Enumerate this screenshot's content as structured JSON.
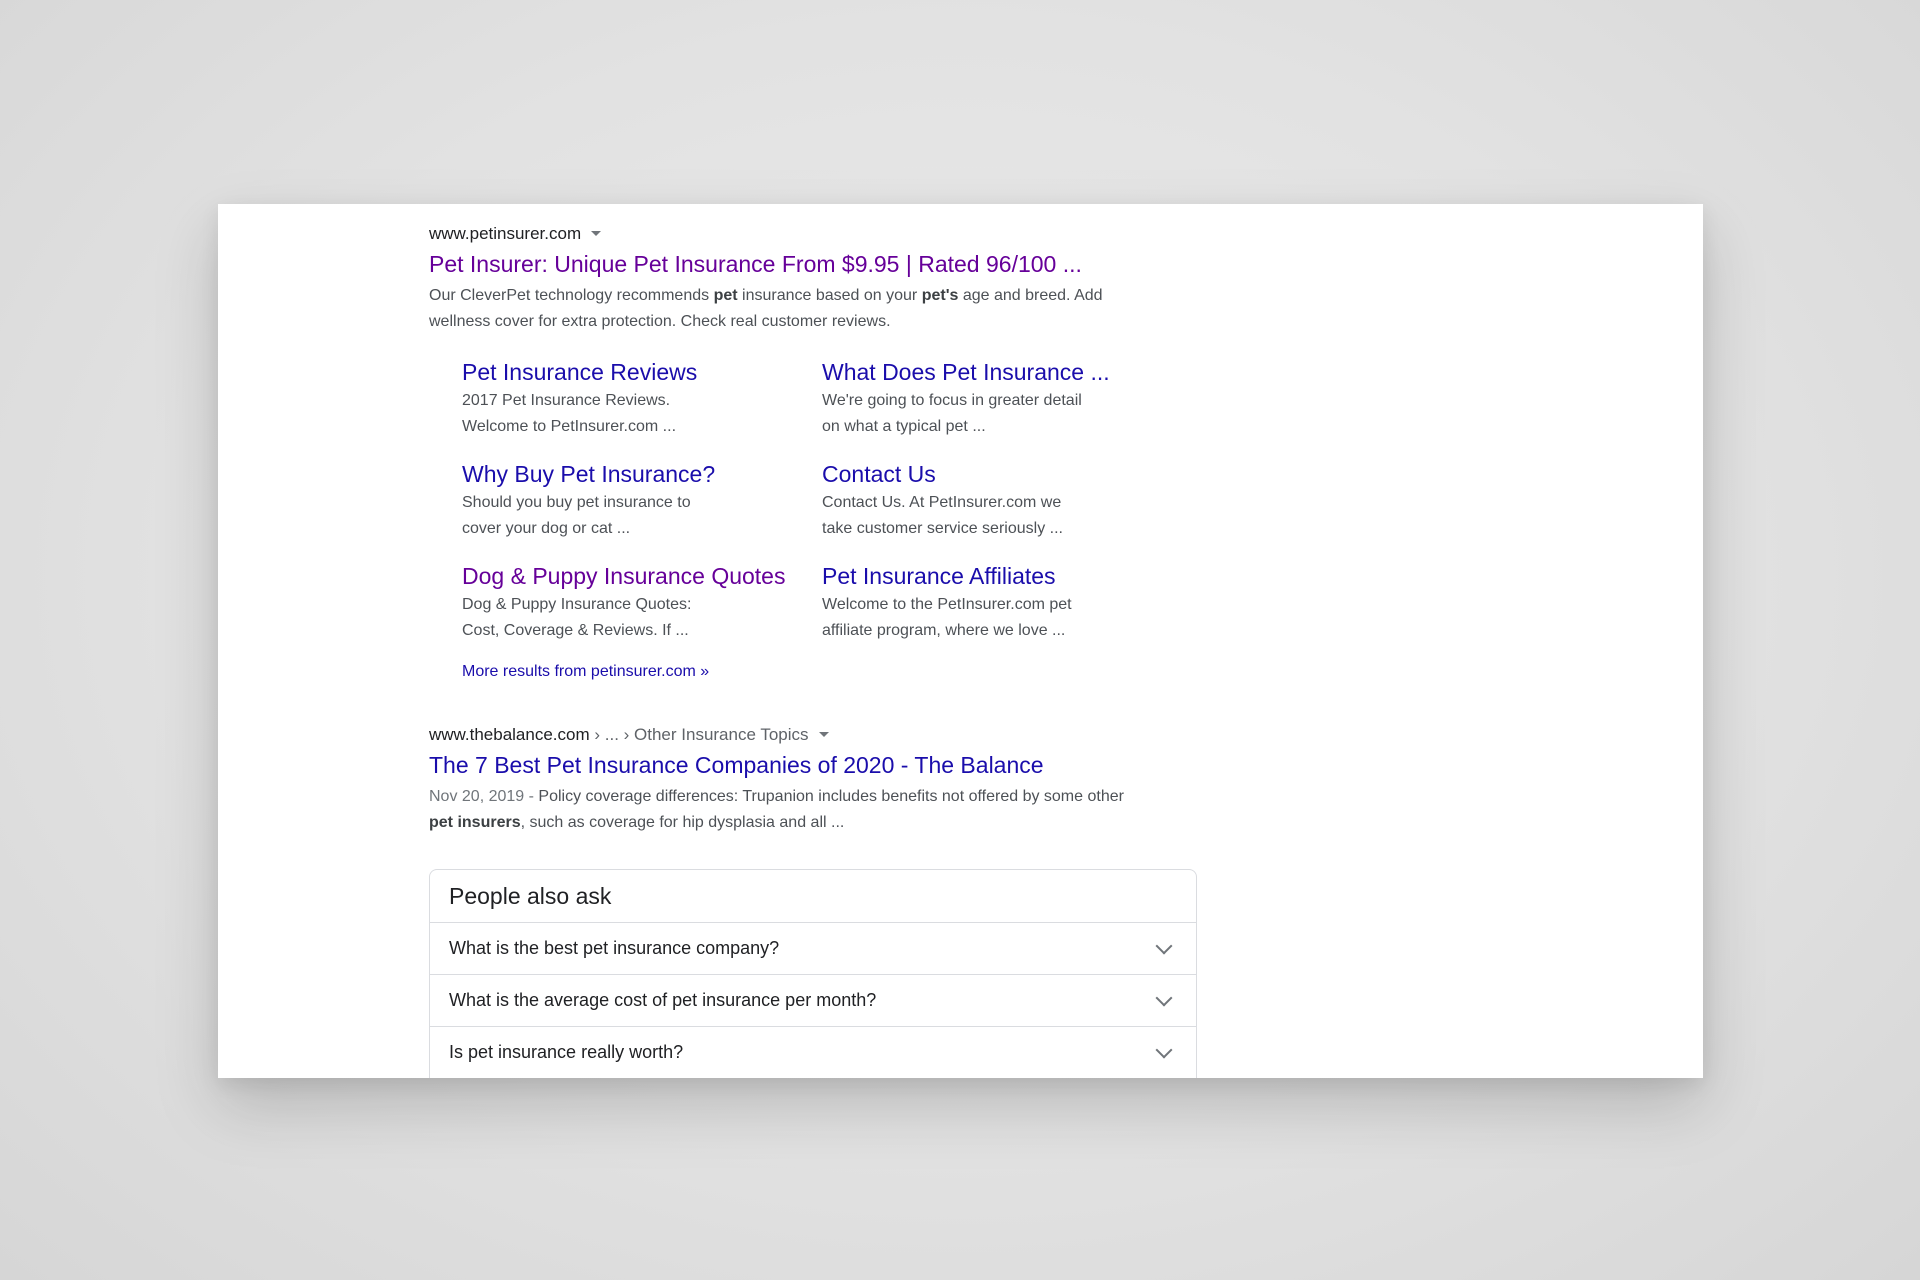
{
  "result1": {
    "cite": "www.petinsurer.com",
    "title": "Pet Insurer: Unique Pet Insurance From $9.95 | Rated 96/100 ...",
    "snippet": {
      "p1": "Our CleverPet technology recommends ",
      "b1": "pet",
      "p2": " insurance based on your ",
      "b2": "pet's",
      "p3": " age and breed. Add wellness cover for extra protection. Check real customer reviews."
    },
    "sitelinks": [
      {
        "title": "Pet Insurance Reviews",
        "desc": "2017 Pet Insurance Reviews. Welcome to PetInsurer.com ..."
      },
      {
        "title": "What Does Pet Insurance ...",
        "desc": "We're going to focus in greater detail on what a typical pet ..."
      },
      {
        "title": "Why Buy Pet Insurance?",
        "desc": "Should you buy pet insurance to cover your dog or cat ..."
      },
      {
        "title": "Contact Us",
        "desc": "Contact Us. At PetInsurer.com we take customer service seriously ..."
      },
      {
        "title": "Dog & Puppy Insurance Quotes",
        "desc": "Dog & Puppy Insurance Quotes: Cost, Coverage & Reviews. If ..."
      },
      {
        "title": "Pet Insurance Affiliates",
        "desc": "Welcome to the PetInsurer.com pet affiliate program, where we love ..."
      }
    ],
    "more": "More results from petinsurer.com »"
  },
  "result2": {
    "cite_domain": "www.thebalance.com",
    "cite_path": " › ... › Other Insurance Topics",
    "title": "The 7 Best Pet Insurance Companies of 2020 - The Balance",
    "date": "Nov 20, 2019 - ",
    "snippet": {
      "p1": "Policy coverage differences: Trupanion includes benefits not offered by some other ",
      "b1": "pet insurers",
      "p2": ", such as coverage for hip dysplasia and all ..."
    }
  },
  "paa": {
    "heading": "People also ask",
    "questions": [
      "What is the best pet insurance company?",
      "What is the average cost of pet insurance per month?",
      "Is pet insurance really worth?"
    ]
  },
  "colors": {
    "visited_link": "#660099",
    "link": "#1a0dab",
    "snippet_text": "#4d5156",
    "border": "#dadce0"
  },
  "icons": {
    "cite_menu": "caret-down-icon",
    "expand": "chevron-down-icon"
  }
}
